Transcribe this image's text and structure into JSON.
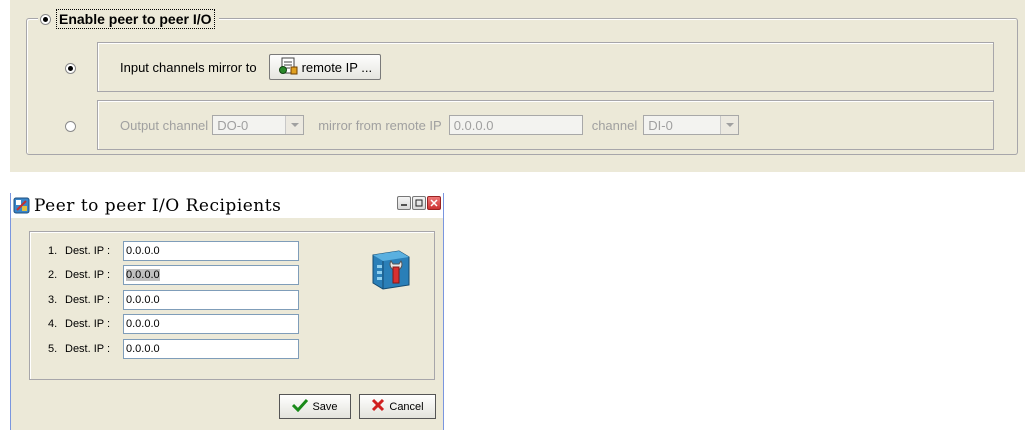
{
  "peer_panel": {
    "enable_label": "Enable peer to peer I/O",
    "input_row": {
      "label": "Input channels mirror to",
      "button_label": "remote IP ..."
    },
    "output_row": {
      "label": "Output channel",
      "output_channel_value": "DO-0",
      "mirror_label": "mirror from remote IP",
      "remote_ip_value": "0.0.0.0",
      "channel_label": "channel",
      "channel_value": "DI-0"
    }
  },
  "dialog": {
    "title": "Peer to peer I/O Recipients",
    "recipients": [
      {
        "num": "1.",
        "label": "Dest. IP :",
        "value": "0.0.0.0"
      },
      {
        "num": "2.",
        "label": "Dest. IP :",
        "value": "0.0.0.0"
      },
      {
        "num": "3.",
        "label": "Dest. IP :",
        "value": "0.0.0.0"
      },
      {
        "num": "4.",
        "label": "Dest. IP :",
        "value": "0.0.0.0"
      },
      {
        "num": "5.",
        "label": "Dest. IP :",
        "value": "0.0.0.0"
      }
    ],
    "save_label": "Save",
    "cancel_label": "Cancel"
  },
  "icons": {
    "remote_ip_button": "network-document-icon",
    "title": "app-icon",
    "tool": "wrench-tool-icon",
    "save": "checkmark-icon",
    "cancel": "x-icon"
  }
}
